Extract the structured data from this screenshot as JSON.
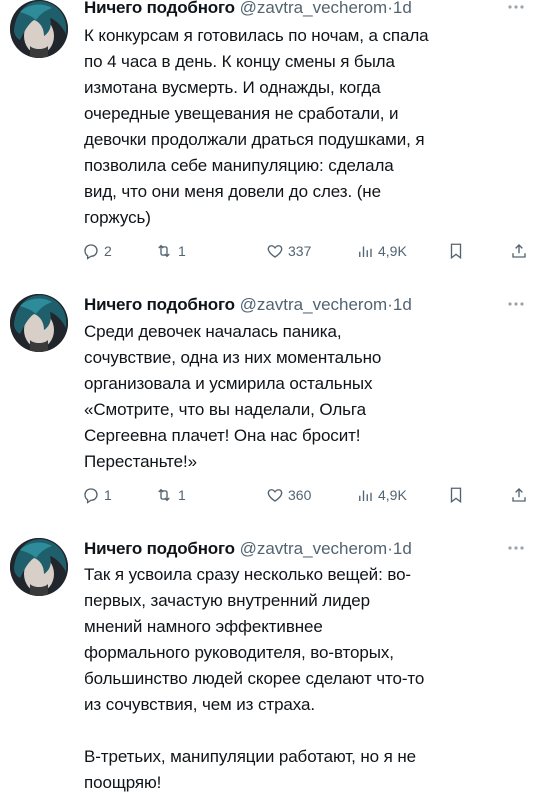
{
  "tweets": [
    {
      "author_name": "Ничего подобного",
      "handle": "@zavtra_vecherom",
      "separator": "·",
      "time": "1d",
      "text": "К конкурсам я готовилась по ночам, а спала\nпо 4 часа в день. К концу смены я была\nизмотана вусмерть. И однажды, когда\nочередные увещевания не сработали, и\nдевочки продолжали драться подушками, я\nпозволила себе манипуляцию: сделала\nвид, что они меня довели до слез. (не\nгоржусь)",
      "replies": "2",
      "retweets": "1",
      "likes": "337",
      "views": "4,9K"
    },
    {
      "author_name": "Ничего подобного",
      "handle": "@zavtra_vecherom",
      "separator": "·",
      "time": "1d",
      "text": "Среди девочек началась паника,\nсочувствие, одна из них моментально\nорганизовала и усмирила остальных\n«Смотрите, что вы наделали, Ольга\nСергеевна плачет! Она нас бросит!\nПерестаньте!»",
      "replies": "1",
      "retweets": "1",
      "likes": "360",
      "views": "4,9K"
    },
    {
      "author_name": "Ничего подобного",
      "handle": "@zavtra_vecherom",
      "separator": "·",
      "time": "1d",
      "text": "Так я усвоила сразу несколько вещей: во-\nпервых, зачастую внутренний лидер\nмнений намного эффективнее\nформального руководителя, во-вторых,\nбольшинство людей скорее сделают что-то\nиз сочувствия, чем из страха.\n\nВ-третьих, манипуляции работают, но я не\nпоощряю!"
    }
  ],
  "icons": {
    "reply": "reply-icon",
    "retweet": "retweet-icon",
    "like": "like-icon",
    "views": "views-icon",
    "bookmark": "bookmark-icon",
    "share": "share-icon",
    "more": "more-icon"
  },
  "colors": {
    "text": "#0f1419",
    "secondary": "#536471"
  }
}
